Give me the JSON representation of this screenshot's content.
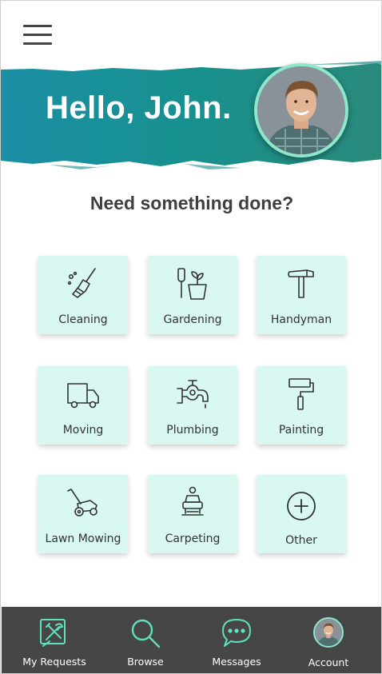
{
  "header": {
    "menu_icon": "hamburger-menu-icon",
    "greeting": "Hello, John.",
    "banner_color": "#1d8e8c",
    "avatar_border_color": "#8ee6cb"
  },
  "prompt": "Need something done?",
  "services": [
    {
      "label": "Cleaning",
      "icon": "broom-icon"
    },
    {
      "label": "Gardening",
      "icon": "plant-pot-icon"
    },
    {
      "label": "Handyman",
      "icon": "hammer-icon"
    },
    {
      "label": "Moving",
      "icon": "truck-icon"
    },
    {
      "label": "Plumbing",
      "icon": "faucet-icon"
    },
    {
      "label": "Painting",
      "icon": "paint-roller-icon"
    },
    {
      "label": "Lawn Mowing",
      "icon": "lawn-mower-icon"
    },
    {
      "label": "Carpeting",
      "icon": "carpet-cleaner-icon"
    },
    {
      "label": "Other",
      "icon": "plus-circle-icon"
    }
  ],
  "tile_color": "#d9f8f1",
  "accent_color": "#5fe0bd",
  "nav": [
    {
      "label": "My Requests",
      "icon": "tools-icon"
    },
    {
      "label": "Browse",
      "icon": "search-icon"
    },
    {
      "label": "Messages",
      "icon": "chat-bubble-icon"
    },
    {
      "label": "Account",
      "icon": "avatar"
    }
  ],
  "navbar_color": "#464646"
}
